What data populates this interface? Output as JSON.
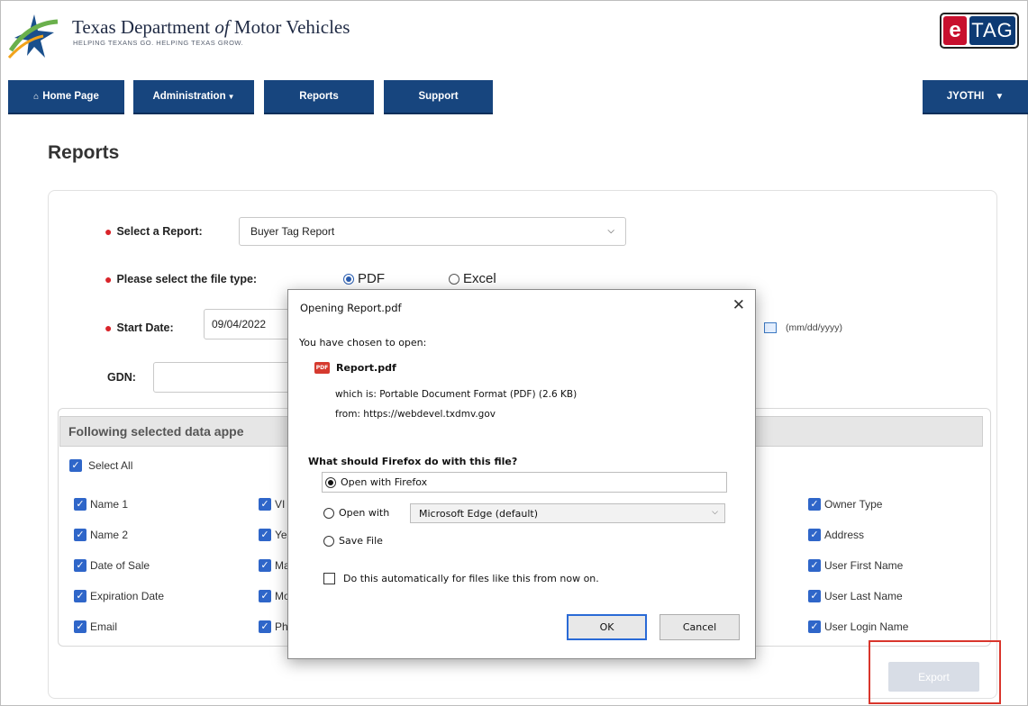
{
  "header": {
    "title_pre": "Texas Department ",
    "title_of": "of",
    "title_post": " Motor Vehicles",
    "tagline": "HELPING TEXANS GO. HELPING TEXAS GROW.",
    "badge_e": "e",
    "badge_tag": "TAG"
  },
  "nav": {
    "home": "Home Page",
    "home_icon": "home-icon",
    "administration": "Administration",
    "reports": "Reports",
    "support": "Support",
    "user": "JYOTHI"
  },
  "page": {
    "title": "Reports"
  },
  "form": {
    "report_label": "Select a Report:",
    "report_value": "Buyer Tag Report",
    "filetype_label": "Please select the file type:",
    "filetype_options": [
      "PDF",
      "Excel"
    ],
    "filetype_selected": "PDF",
    "start_label": "Start Date:",
    "start_value": "09/04/2022",
    "date_format": "(mm/dd/yyyy)",
    "gdn_label": "GDN:"
  },
  "data_section": {
    "heading": "Following selected data appe",
    "select_all": "Select All",
    "col1": [
      "Name 1",
      "Name 2",
      "Date of Sale",
      "Expiration Date",
      "Email"
    ],
    "col2": [
      "VI",
      "Ye",
      "Ma",
      "Mo",
      "Ph"
    ],
    "col4": [
      "Owner Type",
      "Address",
      "User First Name",
      "User Last Name",
      "User Login Name"
    ]
  },
  "export_label": "Export",
  "dialog": {
    "title": "Opening Report.pdf",
    "intro": "You have chosen to open:",
    "file_name": "Report.pdf",
    "which_is": "which is:  Portable Document Format (PDF) (2.6 KB)",
    "from": "from:  https://webdevel.txdmv.gov",
    "question": "What should Firefox do with this file?",
    "open_with_firefox": "Open with Firefox",
    "open_with": "Open with",
    "open_with_app": "Microsoft Edge (default)",
    "save_file": "Save File",
    "auto_checkbox": "Do this automatically for files like this from now on.",
    "ok": "OK",
    "cancel": "Cancel"
  },
  "colors": {
    "nav": "#17457e",
    "checkbox": "#2f66c9",
    "required": "#d9242a",
    "highlight": "#d9362c"
  }
}
